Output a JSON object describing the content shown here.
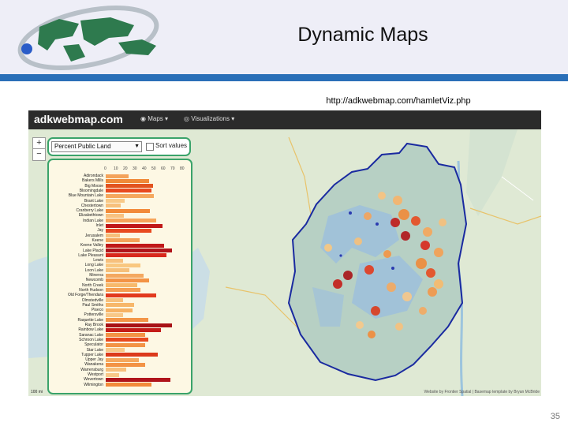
{
  "slide": {
    "title": "Dynamic Maps",
    "url": "http://adkwebmap.com/hamletViz.php",
    "page_number": "35"
  },
  "app": {
    "brand": "adkwebmap.com",
    "nav": [
      {
        "label": "Maps",
        "icon": "globe-icon"
      },
      {
        "label": "Visualizations",
        "icon": "eye-icon"
      }
    ],
    "zoom_in_label": "+",
    "zoom_out_label": "−",
    "attribute_select": "Percent Public Land",
    "sort_label": "Sort values",
    "sort_checked": false,
    "attribution": "Website by Frontier Spatial | Basemap template by Bryan McBride",
    "scale_bar": "100 mi",
    "colors": {
      "navbar": "#2b2b2b",
      "panel_border": "#3aa36a",
      "park_boundary": "#1a2aa0"
    }
  },
  "chart_data": {
    "type": "bar",
    "orientation": "horizontal",
    "axis_ticks": [
      0,
      10,
      20,
      30,
      40,
      50,
      60,
      70,
      80
    ],
    "xlim": [
      0,
      80
    ],
    "categories": [
      "Adirondack",
      "Bakers Mills",
      "Big Moose",
      "Bloomingdale",
      "Blue Mountain Lake",
      "Brant Lake",
      "Chestertown",
      "Cranberry Lake",
      "Elizabethtown",
      "Indian Lake",
      "Inlet",
      "Jay",
      "Jerusalem",
      "Keene",
      "Keene Valley",
      "Lake Placid",
      "Lake Pleasant",
      "Lewis",
      "Long Lake",
      "Loon Lake",
      "Minerva",
      "Newcomb",
      "North Creek",
      "North Hudson",
      "Old Forge/Thendara",
      "Olmstedville",
      "Paul Smiths",
      "Piseco",
      "Pottersville",
      "Raquette Lake",
      "Ray Brook",
      "Rainbow Lake",
      "Saranac Lake",
      "Schroon Lake",
      "Speculator",
      "Star Lake",
      "Tupper Lake",
      "Upper Jay",
      "Wanakena",
      "Warrensburg",
      "Westport",
      "Wevertown",
      "Wilmington"
    ],
    "values": [
      24,
      46,
      50,
      48,
      51,
      20,
      16,
      47,
      19,
      53,
      60,
      48,
      15,
      36,
      62,
      70,
      64,
      18,
      37,
      25,
      40,
      46,
      33,
      37,
      53,
      18,
      30,
      28,
      18,
      45,
      70,
      58,
      42,
      45,
      42,
      20,
      55,
      35,
      42,
      22,
      14,
      68,
      48
    ],
    "bar_colors": [
      "#f4a35a",
      "#f08a38",
      "#e2531f",
      "#e84a20",
      "#f5a85e",
      "#f8c987",
      "#f7c07c",
      "#f28a39",
      "#f8c280",
      "#f6a55a",
      "#c01818",
      "#e84a20",
      "#f7bf7a",
      "#f4a35a",
      "#c01818",
      "#b0141a",
      "#d8281c",
      "#f7c07c",
      "#f9c880",
      "#f6c07a",
      "#f4a860",
      "#f39345",
      "#f7b96c",
      "#f59e52",
      "#e23a1e",
      "#f7c07c",
      "#f7b76a",
      "#f6b264",
      "#f8c888",
      "#f39648",
      "#a81216",
      "#c41c18",
      "#f39345",
      "#e84a20",
      "#f39345",
      "#f8c888",
      "#dc3a1c",
      "#f5a85e",
      "#f39345",
      "#f7c07c",
      "#f8c888",
      "#b0141a",
      "#f28a39"
    ]
  }
}
